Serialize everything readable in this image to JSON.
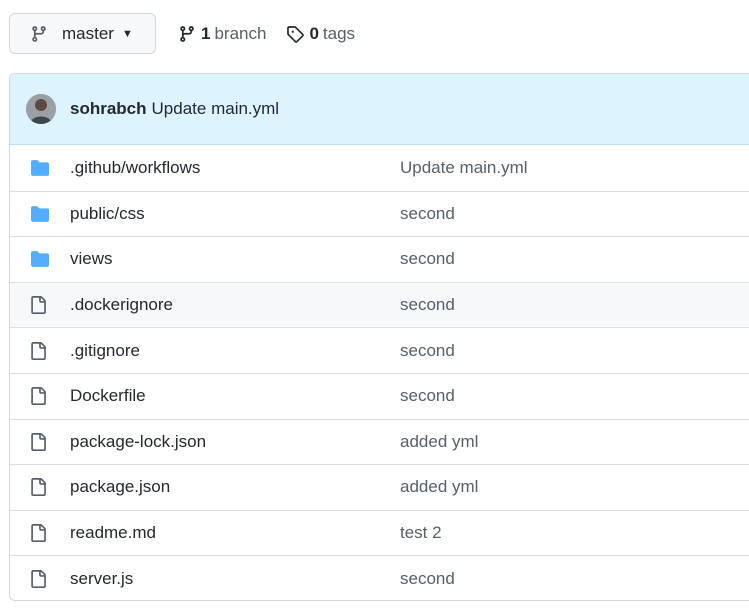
{
  "toolbar": {
    "branch_name": "master",
    "branch_count": "1",
    "branch_label": "branch",
    "tag_count": "0",
    "tag_label": "tags"
  },
  "commit": {
    "author": "sohrabch",
    "message": "Update main.yml"
  },
  "colors": {
    "folder": "#54aeff",
    "file": "#57606a",
    "header_bg": "#ddf4ff"
  },
  "files": [
    {
      "name": ".github/workflows",
      "commit": "Update main.yml",
      "type": "folder-icon"
    },
    {
      "name": "public/css",
      "commit": "second",
      "type": "folder-icon"
    },
    {
      "name": "views",
      "commit": "second",
      "type": "folder-icon"
    },
    {
      "name": ".dockerignore",
      "commit": "second",
      "type": "file-icon"
    },
    {
      "name": ".gitignore",
      "commit": "second",
      "type": "file-icon"
    },
    {
      "name": "Dockerfile",
      "commit": "second",
      "type": "file-icon"
    },
    {
      "name": "package-lock.json",
      "commit": "added yml",
      "type": "file-icon"
    },
    {
      "name": "package.json",
      "commit": "added yml",
      "type": "file-icon"
    },
    {
      "name": "readme.md",
      "commit": "test 2",
      "type": "file-icon"
    },
    {
      "name": "server.js",
      "commit": "second",
      "type": "file-icon"
    }
  ]
}
